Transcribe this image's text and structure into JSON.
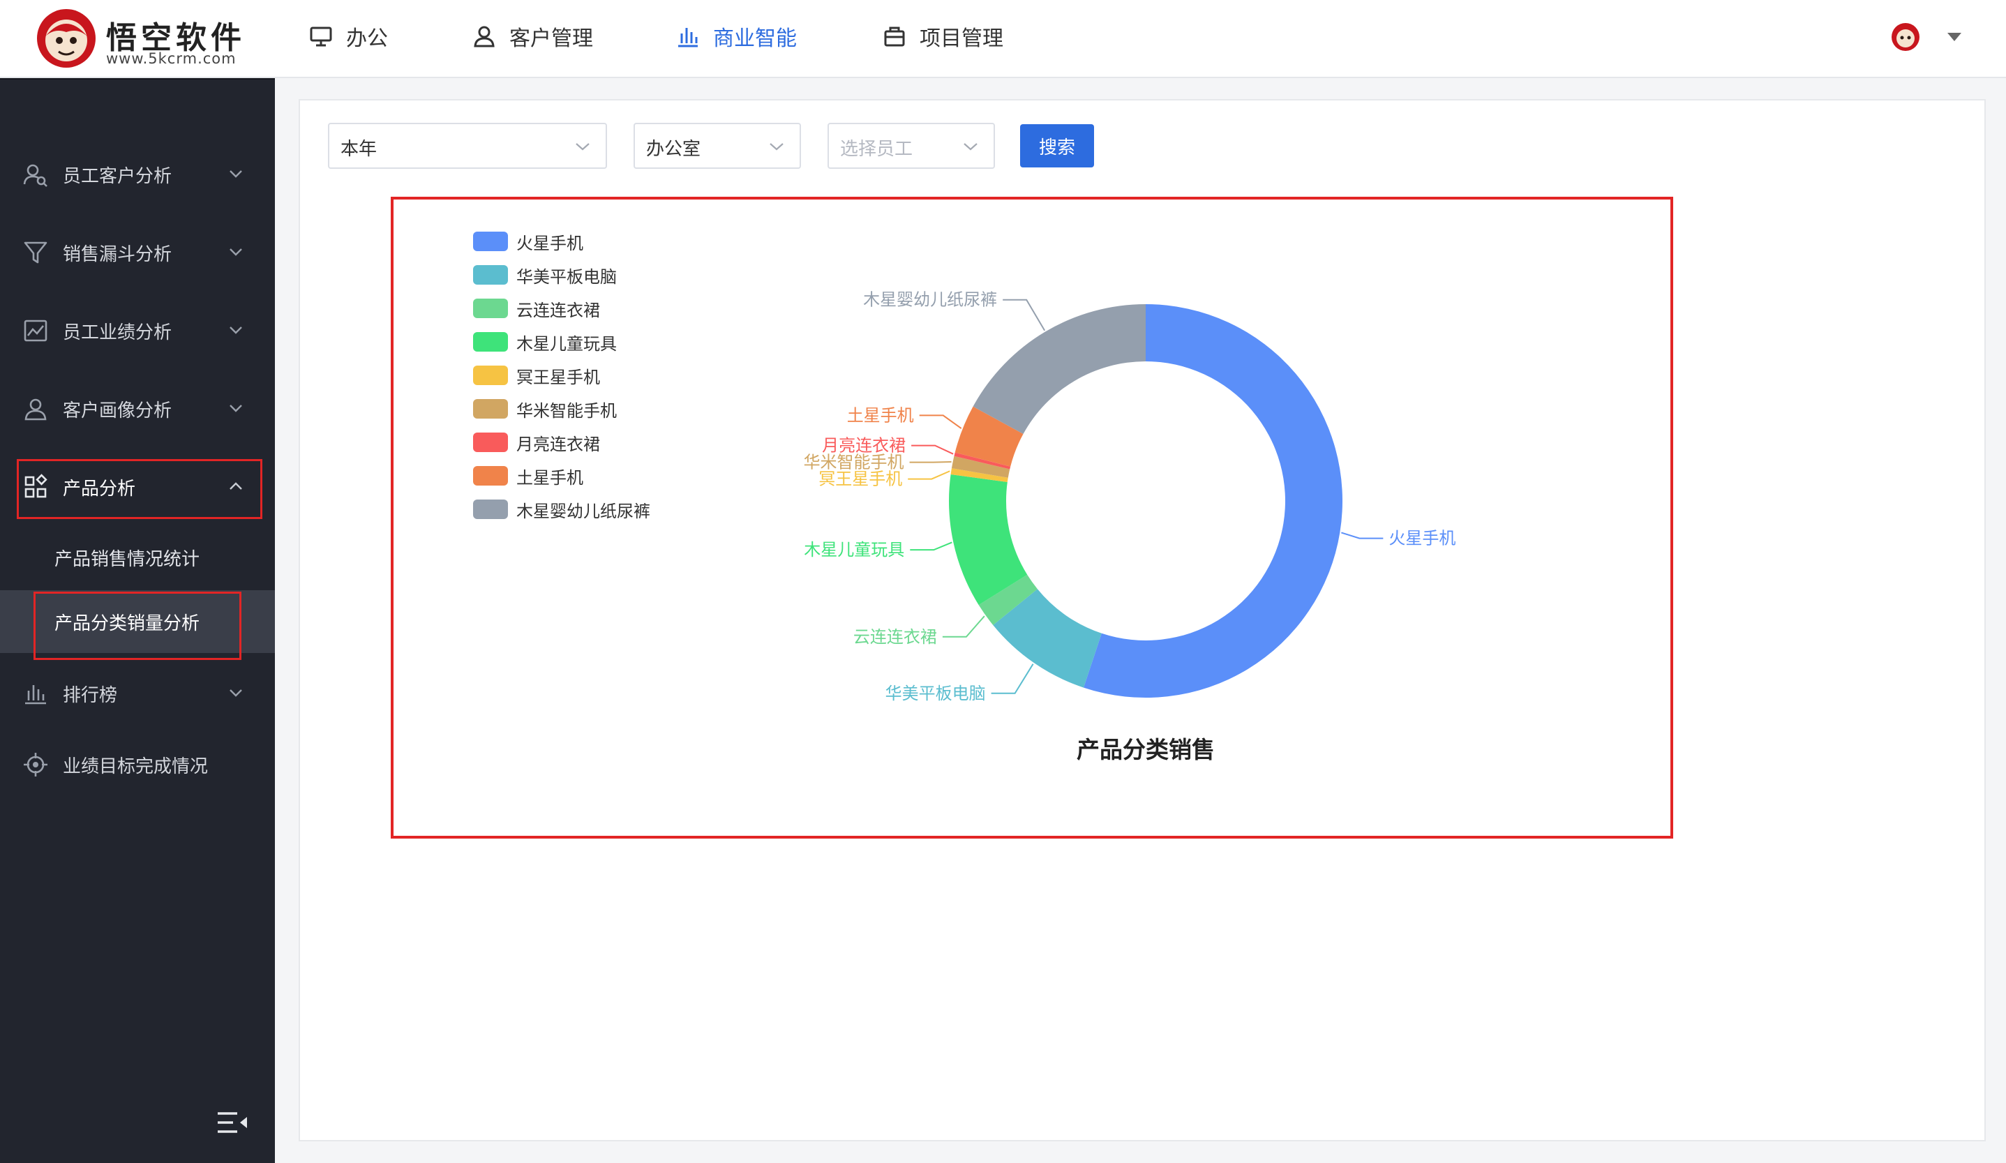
{
  "brand": {
    "name": "悟空软件",
    "url": "www.5kcrm.com"
  },
  "nav": {
    "items": [
      {
        "label": "办公",
        "icon": "monitor-icon"
      },
      {
        "label": "客户管理",
        "icon": "person-icon"
      },
      {
        "label": "商业智能",
        "icon": "bar-chart-icon",
        "active": true
      },
      {
        "label": "项目管理",
        "icon": "briefcase-icon"
      }
    ]
  },
  "sidebar": {
    "items": [
      {
        "label": "员工客户分析",
        "icon": "user-search-icon"
      },
      {
        "label": "销售漏斗分析",
        "icon": "funnel-icon"
      },
      {
        "label": "员工业绩分析",
        "icon": "line-image-icon"
      },
      {
        "label": "客户画像分析",
        "icon": "user-icon"
      },
      {
        "label": "产品分析",
        "icon": "grid-icon",
        "expanded": true
      },
      {
        "label": "排行榜",
        "icon": "bar-chart-icon"
      },
      {
        "label": "业绩目标完成情况",
        "icon": "target-icon"
      }
    ],
    "submenu": [
      {
        "label": "产品销售情况统计"
      },
      {
        "label": "产品分类销量分析",
        "active": true
      }
    ]
  },
  "filters": {
    "period": "本年",
    "department": "办公室",
    "employee_placeholder": "选择员工",
    "search_label": "搜索"
  },
  "colors": {
    "accent": "#2d6cdf",
    "highlight": "#e22525",
    "sidebar_bg": "#22252e"
  },
  "chart_data": {
    "type": "pie",
    "variant": "donut",
    "title": "产品分类销售",
    "legend_position": "top-left",
    "slices": [
      {
        "name": "火星手机",
        "value": 55,
        "color": "#5b8ff9"
      },
      {
        "name": "华美平板电脑",
        "value": 9,
        "color": "#5bbdcf"
      },
      {
        "name": "云连连衣裙",
        "value": 2,
        "color": "#6cd890"
      },
      {
        "name": "木星儿童玩具",
        "value": 11,
        "color": "#3ee37a"
      },
      {
        "name": "冥王星手机",
        "value": 0.5,
        "color": "#f6c343"
      },
      {
        "name": "华米智能手机",
        "value": 1,
        "color": "#d1a662"
      },
      {
        "name": "月亮连衣裙",
        "value": 0.3,
        "color": "#f95b5b"
      },
      {
        "name": "土星手机",
        "value": 4,
        "color": "#f0834a"
      },
      {
        "name": "木星婴幼儿纸尿裤",
        "value": 17,
        "color": "#949fad"
      }
    ]
  }
}
